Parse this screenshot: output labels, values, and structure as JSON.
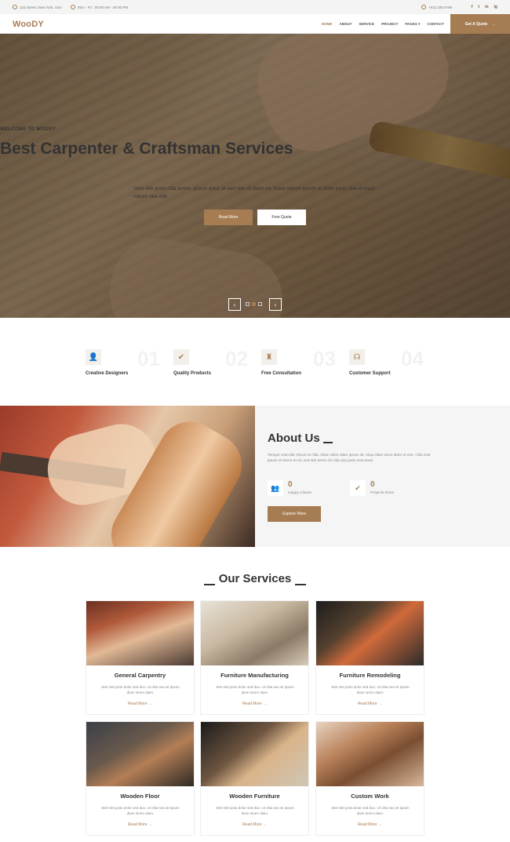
{
  "topbar": {
    "address": "123 Street, New York, USA",
    "hours": "Mon - Fri : 09.00 AM - 09.00 PM",
    "phone": "+012 345 6789",
    "social": [
      "f",
      "t",
      "in",
      "ig"
    ]
  },
  "navbar": {
    "logo": "WooDY",
    "menu": [
      "HOME",
      "ABOUT",
      "SERVICE",
      "PROJECT",
      "PAGES",
      "CONTACT"
    ],
    "quote_button": "Get A Quote"
  },
  "hero": {
    "welcome": "WELCOME TO WOODY",
    "title": "Best Carpenter & Craftsman Services",
    "subtitle": "Vero elitr justo clita lorem. Ipsum dolor at sed stet sit diam no. Kasd rebum ipsum et diam justo clita et kasd rebum sea elitr.",
    "read_more": "Read More",
    "free_quote": "Free Quote"
  },
  "features": [
    {
      "icon": "user-icon",
      "num": "01",
      "label": "Creative Designers"
    },
    {
      "icon": "check-icon",
      "num": "02",
      "label": "Quality Products"
    },
    {
      "icon": "user-tie-icon",
      "num": "03",
      "label": "Free Consultation"
    },
    {
      "icon": "headphones-icon",
      "num": "04",
      "label": "Customer Support"
    }
  ],
  "about": {
    "title": "About Us",
    "text": "Tempor erat elitr rebum at clita. Diam dolor diam ipsum sit. Aliqu diam amet diam et eos. Clita erat ipsum et lorem et sit, sed stet lorem sit clita duo justo erat amet",
    "stats": [
      {
        "icon": "users-icon",
        "value": "0",
        "label": "Happy Clients"
      },
      {
        "icon": "check-icon",
        "value": "0",
        "label": "Projects Done"
      }
    ],
    "button": "Explore More"
  },
  "services": {
    "title": "Our Services",
    "items": [
      {
        "title": "General Carpentry",
        "desc": "Stet stet justo dolor sed duo. Ut clita sea sit ipsum diam lorem diam.",
        "more": "Read More"
      },
      {
        "title": "Furniture Manufacturing",
        "desc": "Stet stet justo dolor sed duo. Ut clita sea sit ipsum diam lorem diam.",
        "more": "Read More"
      },
      {
        "title": "Furniture Remodeling",
        "desc": "Stet stet justo dolor sed duo. Ut clita sea sit ipsum diam lorem diam.",
        "more": "Read More"
      },
      {
        "title": "Wooden Floor",
        "desc": "Stet stet justo dolor sed duo. Ut clita sea sit ipsum diam lorem diam.",
        "more": "Read More"
      },
      {
        "title": "Wooden Furniture",
        "desc": "Stet stet justo dolor sed duo. Ut clita sea sit ipsum diam lorem diam.",
        "more": "Read More"
      },
      {
        "title": "Custom Work",
        "desc": "Stet stet justo dolor sed duo. Ut clita sea sit ipsum diam lorem diam.",
        "more": "Read More"
      }
    ]
  },
  "colors": {
    "accent": "#a67c52"
  }
}
